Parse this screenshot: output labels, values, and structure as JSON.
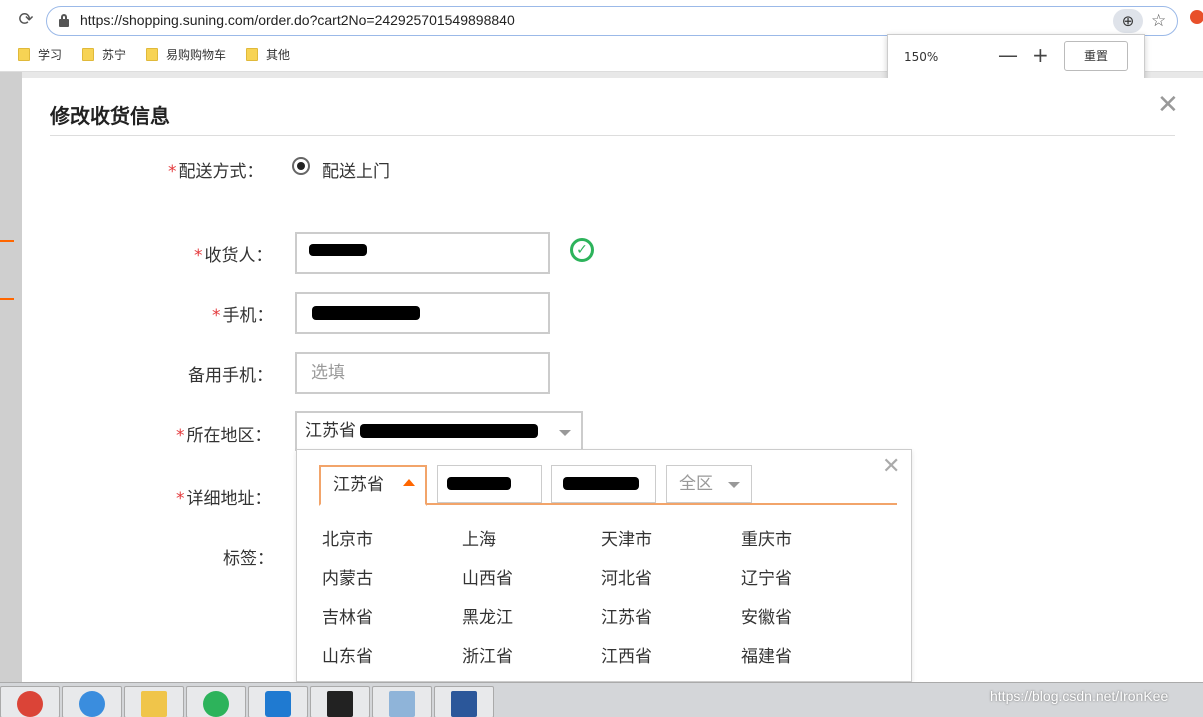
{
  "browser": {
    "url": "https://shopping.suning.com/order.do?cart2No=242925701549898840",
    "bookmarks": [
      "学习",
      "苏宁",
      "易购购物车",
      "其他"
    ],
    "zoom": {
      "level": "150%",
      "minus": "—",
      "plus": "+",
      "reset_label": "重置"
    }
  },
  "modal": {
    "title": "修改收货信息",
    "close_glyph": "✕",
    "delivery": {
      "label": "配送方式：",
      "required": "*",
      "option": "配送上门"
    },
    "receiver": {
      "label": "收货人：",
      "required": "*"
    },
    "phone": {
      "label": "手机：",
      "required": "*"
    },
    "backup_phone": {
      "label": "备用手机：",
      "placeholder": "选填"
    },
    "region": {
      "label": "所在地区：",
      "required": "*",
      "value": "江苏省"
    },
    "address": {
      "label": "详细地址：",
      "required": "*"
    },
    "tag": {
      "label": "标签："
    }
  },
  "region_panel": {
    "close_glyph": "✕",
    "tabs": [
      "江苏省",
      "",
      "",
      "全区"
    ],
    "provinces": [
      "北京市",
      "上海",
      "天津市",
      "重庆市",
      "内蒙古",
      "山西省",
      "河北省",
      "辽宁省",
      "吉林省",
      "黑龙江",
      "江苏省",
      "安徽省",
      "山东省",
      "浙江省",
      "江西省",
      "福建省"
    ]
  },
  "watermark": "https://blog.csdn.net/IronKee",
  "colors": {
    "accent": "#f2a46a",
    "required": "#e4393c",
    "success": "#2db35b"
  }
}
